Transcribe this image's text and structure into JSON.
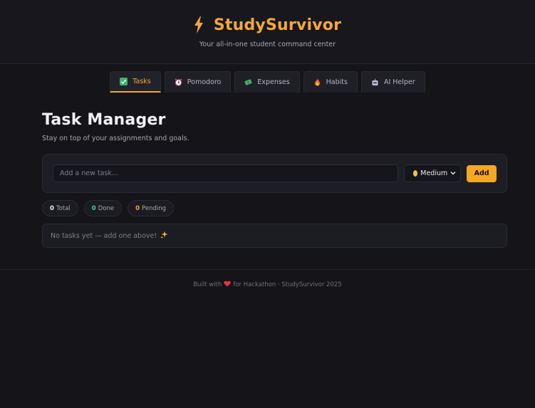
{
  "app": {
    "name": "StudySurvivor",
    "tagline": "Your all-in-one student command center"
  },
  "tabs": [
    {
      "label": "Tasks",
      "icon": "check-box-icon",
      "active": true
    },
    {
      "label": "Pomodoro",
      "icon": "alarm-clock-icon",
      "active": false
    },
    {
      "label": "Expenses",
      "icon": "money-icon",
      "active": false
    },
    {
      "label": "Habits",
      "icon": "fire-icon",
      "active": false
    },
    {
      "label": "AI Helper",
      "icon": "robot-icon",
      "active": false
    }
  ],
  "task_manager": {
    "title": "Task Manager",
    "subtitle": "Stay on top of your assignments and goals.",
    "input_placeholder": "Add a new task...",
    "input_value": "",
    "priority_selected": "Medium",
    "add_label": "Add"
  },
  "stats": {
    "total_count": "0",
    "total_label": "Total",
    "done_count": "0",
    "done_label": "Done",
    "pending_count": "0",
    "pending_label": "Pending"
  },
  "empty_message": "No tasks yet — add one above!",
  "footer": {
    "before": "Built with",
    "after": "for Hackathon · StudySurvivor 2025"
  },
  "colors": {
    "accent": "#f3a83a",
    "background": "#141419",
    "done": "#3dd6a7",
    "heart": "#e8334a"
  }
}
